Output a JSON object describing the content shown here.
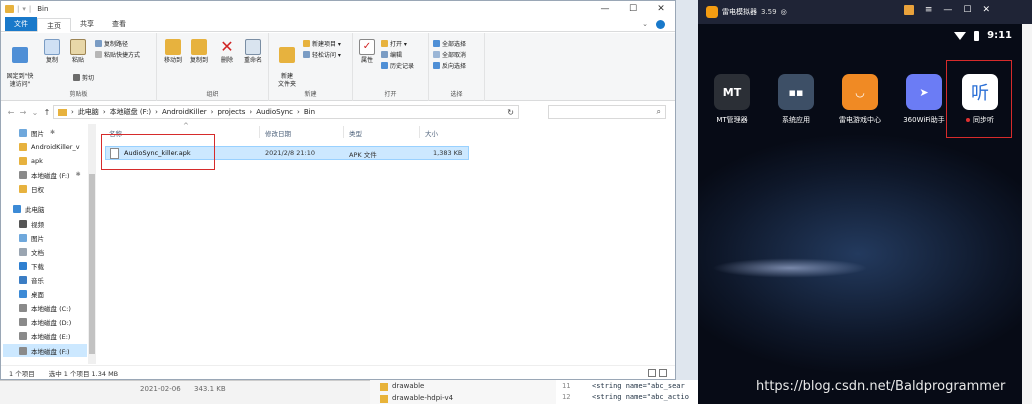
{
  "explorer": {
    "path_title": "Bin",
    "tabs": [
      "文件",
      "主页",
      "共享",
      "查看"
    ],
    "ribbon": {
      "clipboard": {
        "label": "剪贴板",
        "pin": "固定到\"快\n速访问\"",
        "copy": "复制",
        "paste": "粘贴",
        "copy_path": "复制路径",
        "paste_shortcut": "粘贴快捷方式",
        "cut": "剪切"
      },
      "organize": {
        "label": "组织",
        "move_to": "移动到",
        "copy_to": "复制到",
        "delete": "删除",
        "rename": "重命名"
      },
      "new": {
        "label": "新建",
        "new_folder": "新建\n文件夹",
        "new_item": "新建项目 ▾",
        "easy_access": "轻松访问 ▾"
      },
      "open": {
        "label": "打开",
        "properties": "属性",
        "open": "打开 ▾",
        "edit": "编辑",
        "history": "历史记录"
      },
      "select": {
        "label": "选择",
        "select_all": "全部选择",
        "select_none": "全部取消",
        "invert": "反向选择"
      }
    },
    "breadcrumb": [
      "此电脑",
      "本地磁盘 (F:)",
      "AndroidKiller",
      "projects",
      "AudioSync",
      "Bin"
    ],
    "nav": [
      {
        "label": "图片",
        "pinned": true
      },
      {
        "label": "AndroidKiller_v",
        "pinned": false
      },
      {
        "label": "apk",
        "pinned": false
      },
      {
        "label": "本地磁盘 (F:)",
        "pinned": true
      },
      {
        "label": "日权",
        "pinned": false
      },
      {
        "label": "此电脑",
        "pinned": false
      },
      {
        "label": "视频",
        "pinned": false
      },
      {
        "label": "图片",
        "pinned": false
      },
      {
        "label": "文档",
        "pinned": false
      },
      {
        "label": "下载",
        "pinned": false
      },
      {
        "label": "音乐",
        "pinned": false
      },
      {
        "label": "桌面",
        "pinned": false
      },
      {
        "label": "本地磁盘 (C:)",
        "pinned": false
      },
      {
        "label": "本地磁盘 (D:)",
        "pinned": false
      },
      {
        "label": "本地磁盘 (E:)",
        "pinned": false
      },
      {
        "label": "本地磁盘 (F:)",
        "pinned": false
      }
    ],
    "columns": [
      "名称",
      "修改日期",
      "类型",
      "大小"
    ],
    "files": [
      {
        "name": "AudioSync_killer.apk",
        "date": "2021/2/8 21:10",
        "type": "APK 文件",
        "size": "1,383 KB"
      }
    ],
    "status": {
      "count": "1 个项目",
      "selected": "选中 1 个项目  1.34 MB"
    }
  },
  "background": {
    "date": "2021-02-06",
    "size": "343.1 KB",
    "tree": [
      "drawable",
      "drawable-hdpi-v4"
    ],
    "code": [
      {
        "line": "11",
        "text": "<string name=\"abc_sear"
      },
      {
        "line": "12",
        "text": "<string name=\"abc_actio"
      }
    ],
    "watermark": "https://blog.csdn.net/Baldprogrammer"
  },
  "emulator": {
    "title": "雷电模拟器",
    "version": "3.59",
    "time": "9:11",
    "apps": [
      {
        "label": "MT管理器",
        "icon": "MT",
        "color": "#2b2f36"
      },
      {
        "label": "系统应用",
        "icon": "",
        "color": "#3d4f66"
      },
      {
        "label": "雷电游戏中心",
        "icon": "",
        "color": "#f08a24"
      },
      {
        "label": "360WiFi助手",
        "icon": "",
        "color": "#6b7cf5"
      },
      {
        "label": "同步听",
        "icon": "听",
        "color": "#ffffff",
        "dot": true
      }
    ]
  }
}
